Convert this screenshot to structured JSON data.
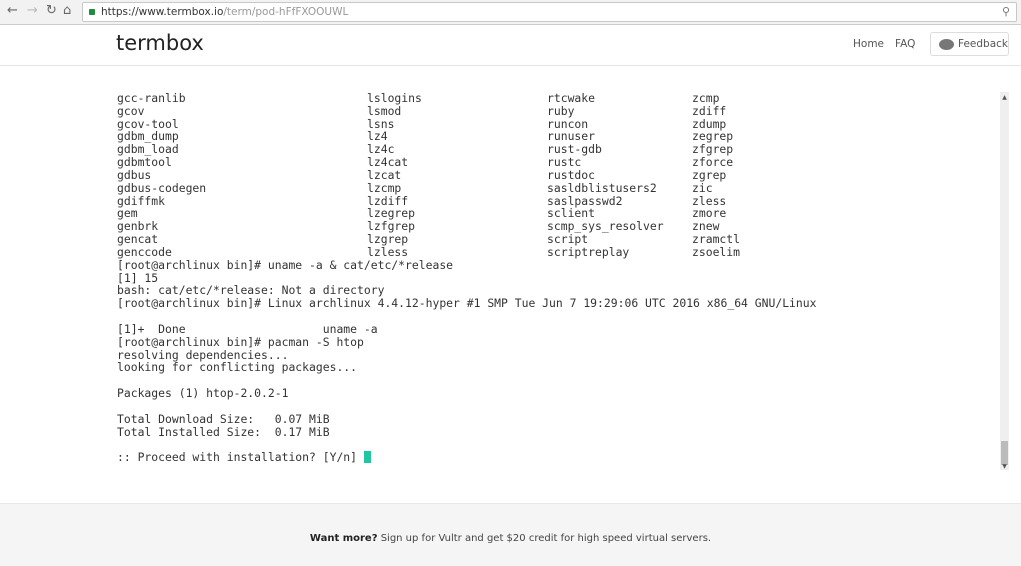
{
  "browser": {
    "url_host": "https://www.termbox.io",
    "url_path": "/term/pod-hFfFXOOUWL"
  },
  "header": {
    "logo": "termbox",
    "nav": [
      "Home",
      "FAQ"
    ],
    "feedback": "Feedback"
  },
  "terminal": {
    "ls_rows": [
      [
        "gcc-ranlib",
        "lslogins",
        "rtcwake",
        "zcmp"
      ],
      [
        "gcov",
        "lsmod",
        "ruby",
        "zdiff"
      ],
      [
        "gcov-tool",
        "lsns",
        "runcon",
        "zdump"
      ],
      [
        "gdbm_dump",
        "lz4",
        "runuser",
        "zegrep"
      ],
      [
        "gdbm_load",
        "lz4c",
        "rust-gdb",
        "zfgrep"
      ],
      [
        "gdbmtool",
        "lz4cat",
        "rustc",
        "zforce"
      ],
      [
        "gdbus",
        "lzcat",
        "rustdoc",
        "zgrep"
      ],
      [
        "gdbus-codegen",
        "lzcmp",
        "sasldblistusers2",
        "zic"
      ],
      [
        "gdiffmk",
        "lzdiff",
        "saslpasswd2",
        "zless"
      ],
      [
        "gem",
        "lzegrep",
        "sclient",
        "zmore"
      ],
      [
        "genbrk",
        "lzfgrep",
        "scmp_sys_resolver",
        "znew"
      ],
      [
        "gencat",
        "lzgrep",
        "script",
        "zramctl"
      ],
      [
        "genccode",
        "lzless",
        "scriptreplay",
        "zsoelim"
      ]
    ],
    "lines": [
      "[root@archlinux bin]# uname -a & cat/etc/*release",
      "[1] 15",
      "bash: cat/etc/*release: Not a directory",
      "[root@archlinux bin]# Linux archlinux 4.4.12-hyper #1 SMP Tue Jun 7 19:29:06 UTC 2016 x86_64 GNU/Linux",
      "",
      "[1]+  Done                    uname -a",
      "[root@archlinux bin]# pacman -S htop",
      "resolving dependencies...",
      "looking for conflicting packages...",
      "",
      "Packages (1) htop-2.0.2-1",
      "",
      "Total Download Size:   0.07 MiB",
      "Total Installed Size:  0.17 MiB",
      "",
      ":: Proceed with installation? [Y/n] "
    ],
    "cursor_color": "#1fc6a0"
  },
  "footer": {
    "bold": "Want more?",
    "text": " Sign up for Vultr and get $20 credit for high speed virtual servers."
  }
}
